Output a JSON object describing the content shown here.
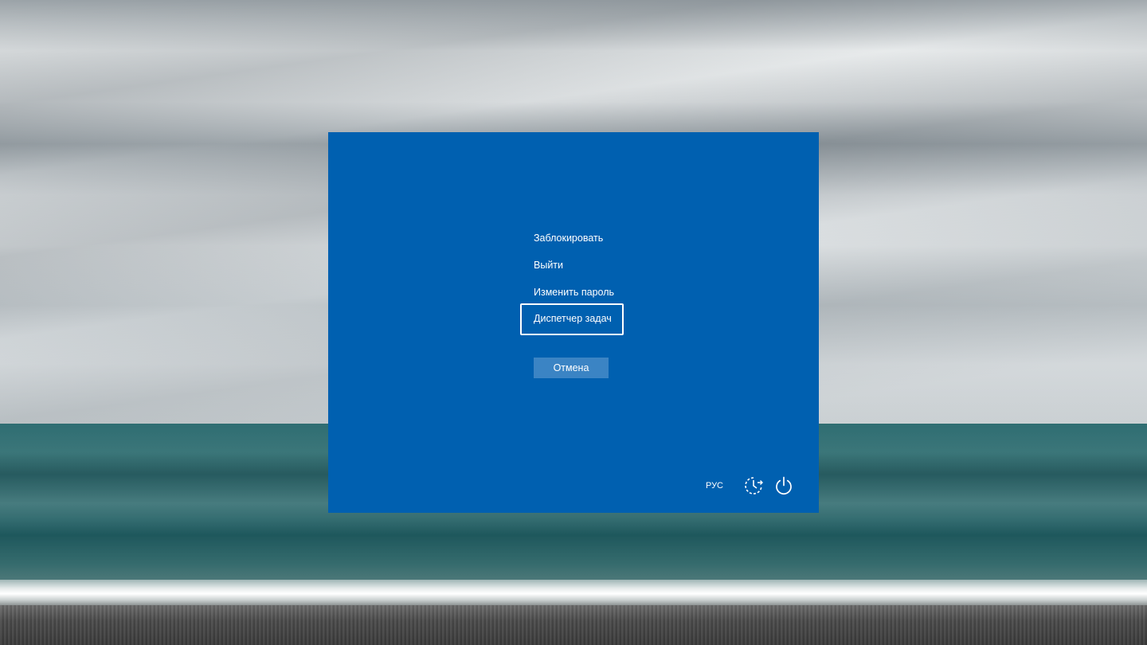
{
  "menu": {
    "items": [
      {
        "label": "Заблокировать"
      },
      {
        "label": "Выйти"
      },
      {
        "label": "Изменить пароль"
      },
      {
        "label": "Диспетчер задач",
        "focused": true
      }
    ]
  },
  "cancel_label": "Отмена",
  "footer": {
    "language": "РУС",
    "accessibility_icon": "ease-of-access-icon",
    "power_icon": "power-icon"
  },
  "colors": {
    "panel": "#0060b0",
    "cancel_button": "#3b84c4",
    "text": "#ffffff"
  }
}
